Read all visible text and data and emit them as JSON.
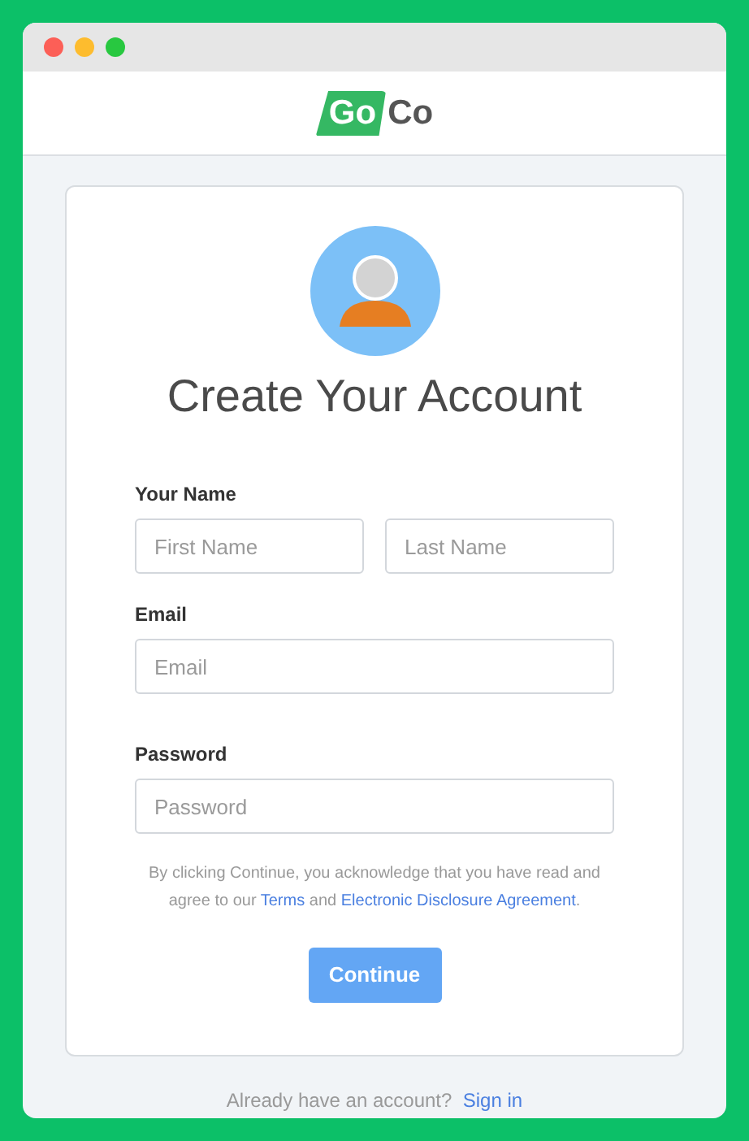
{
  "window": {
    "controls": [
      {
        "color": "#fc5f57"
      },
      {
        "color": "#fdbc2e"
      },
      {
        "color": "#28c840"
      }
    ]
  },
  "logo": {
    "tag": "Go",
    "text": "Co"
  },
  "title": "Create Your Account",
  "form": {
    "name_label": "Your Name",
    "first_name": {
      "placeholder": "First Name"
    },
    "last_name": {
      "placeholder": "Last Name"
    },
    "email_label": "Email",
    "email": {
      "placeholder": "Email"
    },
    "password_label": "Password",
    "password": {
      "placeholder": "Password"
    }
  },
  "disclaimer": [
    {
      "kind": "text",
      "text": "By clicking Continue, you acknowledge that you have read and agree to our "
    },
    {
      "kind": "link",
      "text": "Terms"
    },
    {
      "kind": "text",
      "text": " and "
    },
    {
      "kind": "link",
      "text": "Electronic Disclosure Agreement"
    },
    {
      "kind": "text",
      "text": "."
    }
  ],
  "button": "Continue",
  "footer": {
    "text": "Already have an account?",
    "link": "Sign in"
  }
}
